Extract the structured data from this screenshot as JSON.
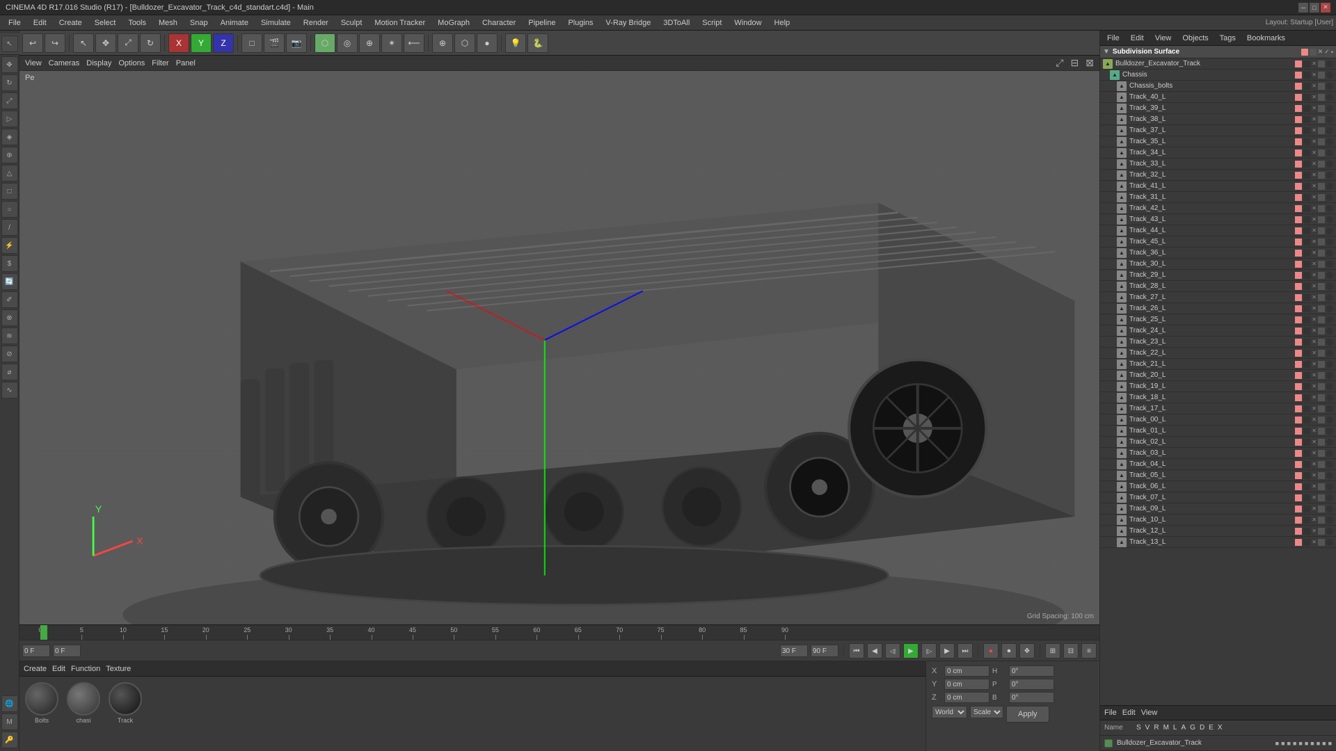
{
  "titlebar": {
    "title": "CINEMA 4D R17.016 Studio (R17) - [Bulldozer_Excavator_Track_c4d_standart.c4d] - Main",
    "layout_label": "Layout: Startup [User]"
  },
  "menubar": {
    "items": [
      "File",
      "Edit",
      "Create",
      "Select",
      "Tools",
      "Mesh",
      "Snap",
      "Animate",
      "Simulate",
      "Render",
      "Sculpt",
      "Motion Tracker",
      "MoGraph",
      "Character",
      "Pipeline",
      "Plugins",
      "V-Ray Bridge",
      "3DtoAll",
      "Script",
      "Window",
      "Help"
    ]
  },
  "toolbar": {
    "undo_label": "↩",
    "tools": [
      "↩",
      "↺",
      "⊕",
      "⊗",
      "△",
      "□",
      "○",
      "✦",
      "◎",
      "✕",
      "Y",
      "Z",
      "□",
      "🎬",
      "📷",
      "⬡",
      "◉",
      "⊕",
      "✶",
      "⟵",
      "⊕",
      "⬡",
      "●",
      "⊕",
      "▣",
      "⊕",
      "⬛",
      "⬛",
      "⬛",
      "★",
      "🔑",
      "🔒"
    ]
  },
  "viewport": {
    "label": "Perspective",
    "toolbar_items": [
      "View",
      "Cameras",
      "Display",
      "Options",
      "Filter",
      "Panel"
    ],
    "grid_spacing": "Grid Spacing: 100 cm"
  },
  "object_manager": {
    "tabs": [
      "File",
      "Edit",
      "View",
      "Objects",
      "Tags",
      "Bookmarks"
    ],
    "root": "Subdivision Surface",
    "items": [
      {
        "name": "Bulldozer_Excavator_Track",
        "indent": 1,
        "type": "model"
      },
      {
        "name": "Chassis",
        "indent": 2,
        "type": "obj"
      },
      {
        "name": "Chassis_bolts",
        "indent": 3,
        "type": "obj"
      },
      {
        "name": "Track_40_L",
        "indent": 3,
        "type": "obj"
      },
      {
        "name": "Track_39_L",
        "indent": 3,
        "type": "obj"
      },
      {
        "name": "Track_38_L",
        "indent": 3,
        "type": "obj"
      },
      {
        "name": "Track_37_L",
        "indent": 3,
        "type": "obj"
      },
      {
        "name": "Track_35_L",
        "indent": 3,
        "type": "obj"
      },
      {
        "name": "Track_34_L",
        "indent": 3,
        "type": "obj"
      },
      {
        "name": "Track_33_L",
        "indent": 3,
        "type": "obj"
      },
      {
        "name": "Track_32_L",
        "indent": 3,
        "type": "obj"
      },
      {
        "name": "Track_41_L",
        "indent": 3,
        "type": "obj"
      },
      {
        "name": "Track_31_L",
        "indent": 3,
        "type": "obj"
      },
      {
        "name": "Track_42_L",
        "indent": 3,
        "type": "obj"
      },
      {
        "name": "Track_43_L",
        "indent": 3,
        "type": "obj"
      },
      {
        "name": "Track_44_L",
        "indent": 3,
        "type": "obj"
      },
      {
        "name": "Track_45_L",
        "indent": 3,
        "type": "obj"
      },
      {
        "name": "Track_36_L",
        "indent": 3,
        "type": "obj"
      },
      {
        "name": "Track_30_L",
        "indent": 3,
        "type": "obj"
      },
      {
        "name": "Track_29_L",
        "indent": 3,
        "type": "obj"
      },
      {
        "name": "Track_28_L",
        "indent": 3,
        "type": "obj"
      },
      {
        "name": "Track_27_L",
        "indent": 3,
        "type": "obj"
      },
      {
        "name": "Track_26_L",
        "indent": 3,
        "type": "obj"
      },
      {
        "name": "Track_25_L",
        "indent": 3,
        "type": "obj"
      },
      {
        "name": "Track_24_L",
        "indent": 3,
        "type": "obj"
      },
      {
        "name": "Track_23_L",
        "indent": 3,
        "type": "obj"
      },
      {
        "name": "Track_22_L",
        "indent": 3,
        "type": "obj"
      },
      {
        "name": "Track_21_L",
        "indent": 3,
        "type": "obj"
      },
      {
        "name": "Track_20_L",
        "indent": 3,
        "type": "obj"
      },
      {
        "name": "Track_19_L",
        "indent": 3,
        "type": "obj"
      },
      {
        "name": "Track_18_L",
        "indent": 3,
        "type": "obj"
      },
      {
        "name": "Track_17_L",
        "indent": 3,
        "type": "obj"
      },
      {
        "name": "Track_00_L",
        "indent": 3,
        "type": "obj"
      },
      {
        "name": "Track_01_L",
        "indent": 3,
        "type": "obj"
      },
      {
        "name": "Track_02_L",
        "indent": 3,
        "type": "obj"
      },
      {
        "name": "Track_03_L",
        "indent": 3,
        "type": "obj"
      },
      {
        "name": "Track_04_L",
        "indent": 3,
        "type": "obj"
      },
      {
        "name": "Track_05_L",
        "indent": 3,
        "type": "obj"
      },
      {
        "name": "Track_06_L",
        "indent": 3,
        "type": "obj"
      },
      {
        "name": "Track_07_L",
        "indent": 3,
        "type": "obj"
      },
      {
        "name": "Track_09_L",
        "indent": 3,
        "type": "obj"
      },
      {
        "name": "Track_10_L",
        "indent": 3,
        "type": "obj"
      },
      {
        "name": "Track_12_L",
        "indent": 3,
        "type": "obj"
      },
      {
        "name": "Track_13_L",
        "indent": 3,
        "type": "obj"
      }
    ]
  },
  "material_editor": {
    "tabs": [
      "Create",
      "Edit",
      "Function",
      "Texture"
    ],
    "materials": [
      {
        "name": "Bolts",
        "color": "#444"
      },
      {
        "name": "chasi",
        "color": "#555"
      },
      {
        "name": "Track",
        "color": "#3a3a3a"
      }
    ]
  },
  "coordinates": {
    "x_label": "X",
    "x_val": "0 cm",
    "y_label": "Y",
    "y_val": "0 cm",
    "z_label": "Z",
    "z_val": "0 cm",
    "h_label": "H",
    "h_val": "0°",
    "p_label": "P",
    "p_val": "0°",
    "b_label": "B",
    "b_val": "0°",
    "coord_system": "World",
    "scale_label": "Scale"
  },
  "attributes_panel": {
    "tabs_top": [
      "File",
      "Edit",
      "View",
      "Objects",
      "Tags",
      "Bookmarks"
    ],
    "tabs_bottom": [
      "File",
      "Edit",
      "View"
    ],
    "name_label": "Name",
    "name_val": "Bulldozer_Excavator_Track",
    "columns": [
      "S",
      "V",
      "R",
      "M",
      "L",
      "A",
      "G",
      "D",
      "E",
      "X"
    ],
    "apply_label": "Apply"
  },
  "timeline": {
    "start": "0 F",
    "end": "90 F",
    "fps": "30 F",
    "current": "0 F",
    "markers": [
      "0",
      "5",
      "10",
      "15",
      "20",
      "25",
      "30",
      "35",
      "40",
      "45",
      "50",
      "55",
      "60",
      "65",
      "70",
      "75",
      "80",
      "85",
      "90"
    ]
  },
  "icons": {
    "model_icon": "▲",
    "group_icon": "◉",
    "obj_icon": "▲",
    "play": "▶",
    "stop": "■",
    "prev": "⏮",
    "next": "⏭",
    "prev_frame": "◀",
    "next_frame": "▶"
  }
}
